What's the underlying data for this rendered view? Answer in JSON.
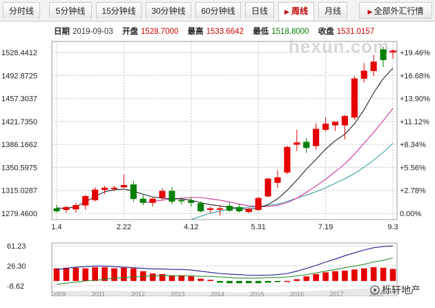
{
  "tabs": [
    {
      "label": "分时线",
      "active": false
    },
    {
      "label": "5分钟线",
      "active": false
    },
    {
      "label": "15分钟线",
      "active": false
    },
    {
      "label": "30分钟线",
      "active": false
    },
    {
      "label": "60分钟线",
      "active": false
    },
    {
      "label": "日线",
      "active": false
    },
    {
      "label": "周线",
      "active": true
    },
    {
      "label": "月线",
      "active": false
    }
  ],
  "all_fx_label": "全部外汇行情",
  "info": {
    "date_label": "日期",
    "date": "2019-09-03",
    "open_label": "开盘",
    "open": "1528.7000",
    "high_label": "最高",
    "high": "1533.6642",
    "low_label": "最低",
    "low": "1518.8000",
    "close_label": "收盘",
    "close": "1531.0157"
  },
  "watermark": "hexun.com",
  "logo_text": "栎轩地产",
  "colors": {
    "up": "#e60000",
    "down": "#008000",
    "ma_black": "#222222",
    "ma_magenta": "#cc3399",
    "ma_teal": "#3a9f9f"
  },
  "chart_data": {
    "type": "candlestick",
    "y_axis_left_ticks": [
      "1528.4412",
      "1492.8725",
      "1457.3037",
      "1421.7350",
      "1386.1662",
      "1350.5975",
      "1315.0287",
      "1279.4600"
    ],
    "y_axis_right_ticks": [
      "+19.46%",
      "+16.68%",
      "+13.90%",
      "+11.12%",
      "+8.34%",
      "+5.56%",
      "+2.78%",
      "0.00%"
    ],
    "x_ticks": [
      {
        "index": 0,
        "label": "1.4"
      },
      {
        "index": 7,
        "label": "2.22"
      },
      {
        "index": 14,
        "label": "4.12"
      },
      {
        "index": 21,
        "label": "5.31"
      },
      {
        "index": 28,
        "label": "7.19"
      },
      {
        "index": 35,
        "label": "9.3"
      }
    ],
    "ylim": [
      1279.46,
      1528.4412
    ],
    "candles": [
      {
        "o": 1287.0,
        "h": 1293.0,
        "l": 1281.0,
        "c": 1283.0
      },
      {
        "o": 1285.0,
        "h": 1291.0,
        "l": 1280.0,
        "c": 1289.0
      },
      {
        "o": 1286.0,
        "h": 1296.0,
        "l": 1281.0,
        "c": 1292.0
      },
      {
        "o": 1292.0,
        "h": 1308.0,
        "l": 1285.0,
        "c": 1306.0
      },
      {
        "o": 1300.0,
        "h": 1320.0,
        "l": 1298.0,
        "c": 1316.0
      },
      {
        "o": 1316.0,
        "h": 1322.0,
        "l": 1309.0,
        "c": 1319.0
      },
      {
        "o": 1318.0,
        "h": 1322.0,
        "l": 1314.0,
        "c": 1319.0
      },
      {
        "o": 1320.0,
        "h": 1340.0,
        "l": 1319.0,
        "c": 1323.0
      },
      {
        "o": 1324.0,
        "h": 1330.0,
        "l": 1297.0,
        "c": 1302.0
      },
      {
        "o": 1302.0,
        "h": 1308.0,
        "l": 1292.0,
        "c": 1296.0
      },
      {
        "o": 1296.0,
        "h": 1304.0,
        "l": 1290.0,
        "c": 1302.0
      },
      {
        "o": 1304.0,
        "h": 1318.0,
        "l": 1300.0,
        "c": 1314.0
      },
      {
        "o": 1314.0,
        "h": 1320.0,
        "l": 1294.0,
        "c": 1298.0
      },
      {
        "o": 1300.0,
        "h": 1304.0,
        "l": 1293.0,
        "c": 1299.0
      },
      {
        "o": 1299.0,
        "h": 1304.0,
        "l": 1290.0,
        "c": 1296.0
      },
      {
        "o": 1295.0,
        "h": 1298.0,
        "l": 1281.0,
        "c": 1283.0
      },
      {
        "o": 1285.0,
        "h": 1290.0,
        "l": 1280.0,
        "c": 1287.0
      },
      {
        "o": 1287.0,
        "h": 1292.0,
        "l": 1276.0,
        "c": 1287.0
      },
      {
        "o": 1291.0,
        "h": 1296.0,
        "l": 1282.0,
        "c": 1284.0
      },
      {
        "o": 1289.0,
        "h": 1294.0,
        "l": 1281.0,
        "c": 1283.0
      },
      {
        "o": 1282.0,
        "h": 1288.0,
        "l": 1280.0,
        "c": 1286.0
      },
      {
        "o": 1285.0,
        "h": 1305.0,
        "l": 1283.0,
        "c": 1303.0
      },
      {
        "o": 1306.0,
        "h": 1334.0,
        "l": 1305.0,
        "c": 1333.0
      },
      {
        "o": 1327.0,
        "h": 1346.0,
        "l": 1319.0,
        "c": 1335.0
      },
      {
        "o": 1343.0,
        "h": 1384.0,
        "l": 1340.0,
        "c": 1382.0
      },
      {
        "o": 1386.0,
        "h": 1409.0,
        "l": 1376.0,
        "c": 1389.0
      },
      {
        "o": 1390.0,
        "h": 1396.0,
        "l": 1373.0,
        "c": 1381.0
      },
      {
        "o": 1384.0,
        "h": 1419.0,
        "l": 1378.0,
        "c": 1410.0
      },
      {
        "o": 1409.0,
        "h": 1428.0,
        "l": 1406.0,
        "c": 1418.0
      },
      {
        "o": 1416.0,
        "h": 1421.0,
        "l": 1407.0,
        "c": 1421.0
      },
      {
        "o": 1416.0,
        "h": 1432.0,
        "l": 1394.0,
        "c": 1430.0
      },
      {
        "o": 1428.0,
        "h": 1492.0,
        "l": 1424.0,
        "c": 1488.0
      },
      {
        "o": 1488.0,
        "h": 1512.0,
        "l": 1482.0,
        "c": 1500.0
      },
      {
        "o": 1500.0,
        "h": 1525.0,
        "l": 1492.0,
        "c": 1514.0
      },
      {
        "o": 1533.0,
        "h": 1537.0,
        "l": 1506.0,
        "c": 1517.0
      },
      {
        "o": 1528.7,
        "h": 1533.6642,
        "l": 1518.8,
        "c": 1531.0157
      }
    ],
    "ma_black": [
      1288,
      1287,
      1290,
      1297,
      1306,
      1313,
      1316,
      1317,
      1314,
      1309,
      1305,
      1303,
      1302,
      1302,
      1300,
      1296,
      1293,
      1291,
      1289,
      1287,
      1286,
      1288,
      1293,
      1302,
      1315,
      1331,
      1348,
      1363,
      1379,
      1392,
      1402,
      1418,
      1440,
      1466,
      1488,
      1504
    ],
    "ma_magenta": [
      null,
      null,
      null,
      null,
      null,
      null,
      null,
      null,
      null,
      1296,
      1298,
      1300,
      1302,
      1303,
      1304,
      1304,
      1302,
      1300,
      1297,
      1294,
      1291,
      1290,
      1290,
      1292,
      1296,
      1303,
      1312,
      1322,
      1332,
      1344,
      1356,
      1371,
      1388,
      1405,
      1423,
      1442
    ],
    "ma_teal": [
      null,
      null,
      null,
      null,
      null,
      null,
      null,
      null,
      null,
      null,
      null,
      null,
      null,
      null,
      1270,
      1275,
      1280,
      1283,
      1286,
      1288,
      1289,
      1290,
      1292,
      1294,
      1298,
      1303,
      1308,
      1313,
      1319,
      1326,
      1333,
      1341,
      1351,
      1362,
      1374,
      1388
    ],
    "sub_panel": {
      "y_ticks": [
        "61.23",
        "26.30",
        "-8.62"
      ],
      "ylim": [
        -8.62,
        61.23
      ],
      "x_year_labels": [
        "2009",
        "2011",
        "2012",
        "2013",
        "2014",
        "2015",
        "2016",
        "2017",
        "2018"
      ],
      "bars": [
        22,
        23,
        23,
        22,
        24,
        24,
        22,
        23,
        22,
        17,
        13,
        12,
        10,
        10,
        8,
        4,
        2,
        -3,
        -4,
        -4,
        -4,
        -4,
        -3,
        -2,
        0,
        3,
        8,
        12,
        15,
        17,
        18,
        20,
        22,
        24,
        23,
        21
      ],
      "line_blue": [
        20,
        22,
        24,
        25,
        26,
        26,
        25,
        24,
        23,
        22,
        21,
        21,
        20,
        20,
        19,
        17,
        15,
        13,
        12,
        11,
        10,
        10,
        10,
        11,
        13,
        17,
        22,
        27,
        33,
        38,
        44,
        49,
        54,
        58,
        60,
        61
      ],
      "line_green": [
        -6,
        -4,
        -2,
        0,
        1,
        3,
        5,
        6,
        7,
        8,
        9,
        9,
        9,
        9,
        9,
        8,
        8,
        7,
        6,
        5,
        5,
        5,
        6,
        6,
        7,
        9,
        11,
        14,
        17,
        20,
        23,
        26,
        29,
        33,
        36,
        40
      ]
    }
  }
}
